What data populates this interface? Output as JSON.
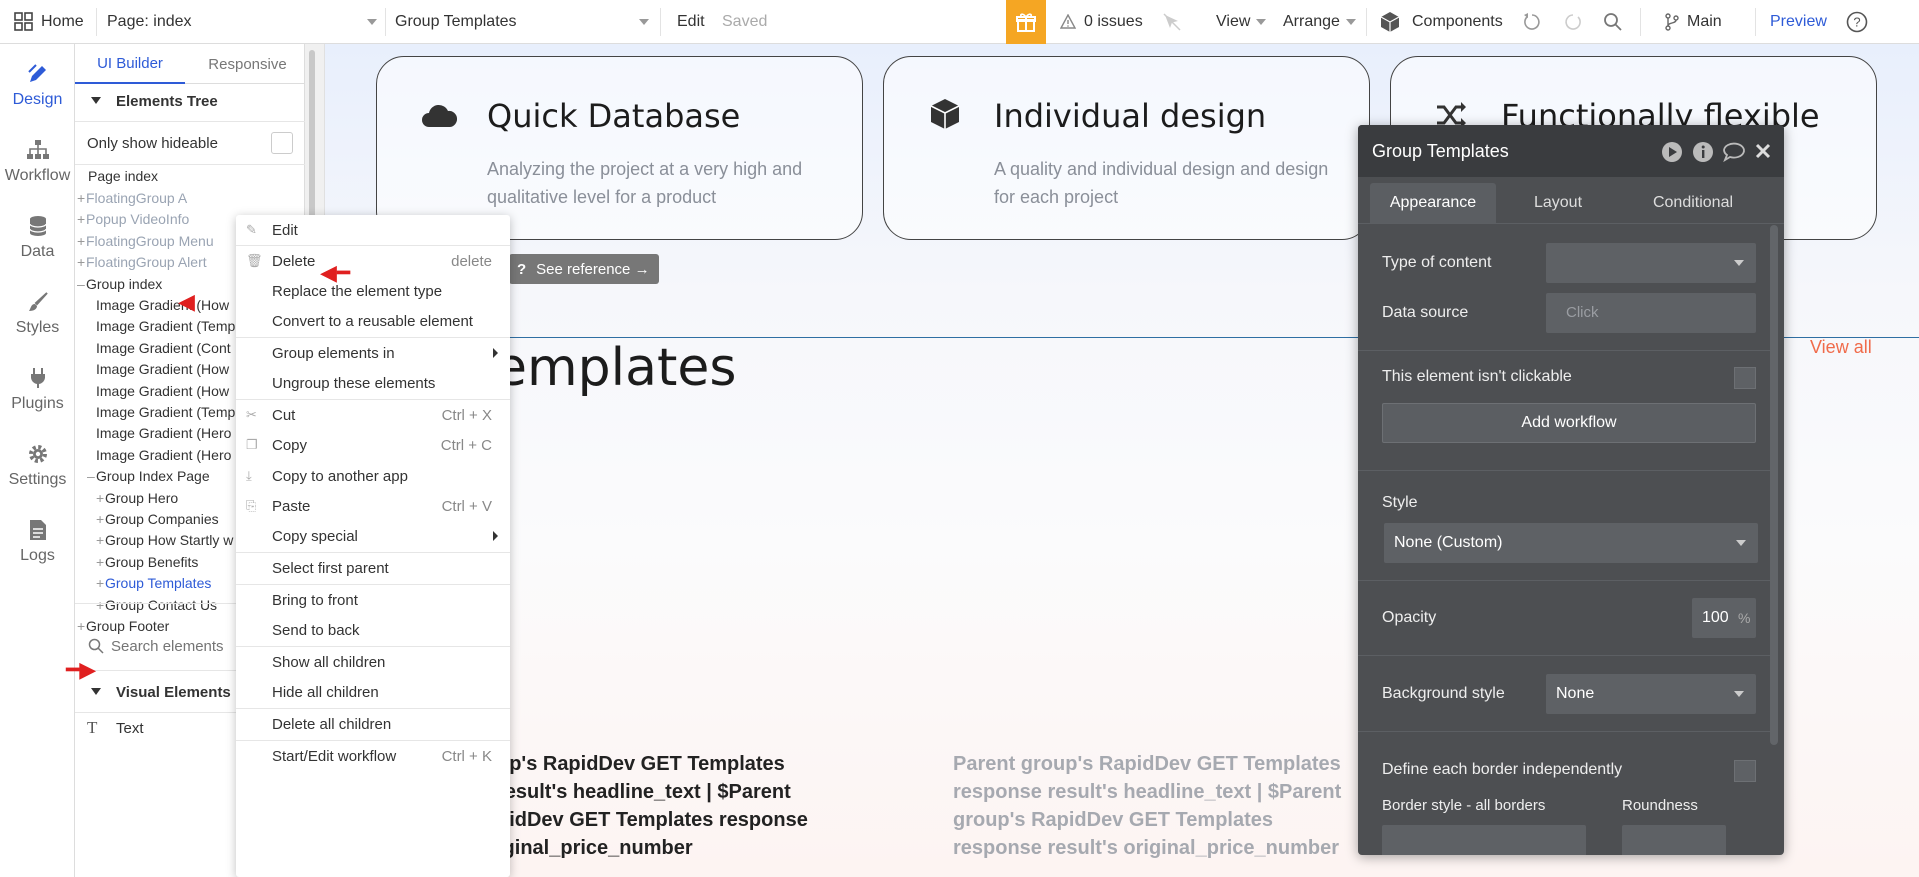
{
  "topbar": {
    "home": "Home",
    "page_select": "Page: index",
    "element_select": "Group Templates",
    "edit": "Edit",
    "saved": "Saved",
    "issues": "0 issues",
    "view": "View",
    "arrange": "Arrange",
    "components": "Components",
    "branch": "Main",
    "preview": "Preview",
    "gift_color": "#f5a623"
  },
  "leftnav": {
    "items": [
      {
        "label": "Design",
        "icon": "pen-icon"
      },
      {
        "label": "Workflow",
        "icon": "sitemap-icon"
      },
      {
        "label": "Data",
        "icon": "database-icon"
      },
      {
        "label": "Styles",
        "icon": "brush-icon"
      },
      {
        "label": "Plugins",
        "icon": "plug-icon"
      },
      {
        "label": "Settings",
        "icon": "gear-icon"
      },
      {
        "label": "Logs",
        "icon": "document-icon"
      }
    ],
    "active_color": "#2e5bd7"
  },
  "panel": {
    "tab_builder": "UI Builder",
    "tab_responsive": "Responsive",
    "elements_tree": "Elements Tree",
    "only_hideable": "Only show hideable",
    "page_index": "Page index",
    "tree": [
      {
        "label": "FloatingGroup A",
        "pm": "+",
        "faded": true
      },
      {
        "label": "Popup VideoInfo",
        "pm": "+",
        "faded": true
      },
      {
        "label": "FloatingGroup Menu",
        "pm": "+",
        "faded": true
      },
      {
        "label": "FloatingGroup Alert",
        "pm": "+",
        "faded": true
      },
      {
        "label": "Group index",
        "pm": "–",
        "faded": false
      },
      {
        "label": "Image Gradient (How",
        "pm": "",
        "faded": false
      },
      {
        "label": "Image Gradient (Temp",
        "pm": "",
        "faded": false
      },
      {
        "label": "Image Gradient (Cont",
        "pm": "",
        "faded": false
      },
      {
        "label": "Image Gradient (How",
        "pm": "",
        "faded": false
      },
      {
        "label": "Image Gradient (How",
        "pm": "",
        "faded": false
      },
      {
        "label": "Image Gradient (Temp",
        "pm": "",
        "faded": false
      },
      {
        "label": "Image Gradient (Hero",
        "pm": "",
        "faded": false
      },
      {
        "label": "Image Gradient (Hero",
        "pm": "",
        "faded": false
      },
      {
        "label": "Group Index Page",
        "pm": "–",
        "faded": false
      },
      {
        "label": "Group Hero",
        "pm": "+",
        "faded": false
      },
      {
        "label": "Group Companies",
        "pm": "+",
        "faded": false
      },
      {
        "label": "Group How Startly w",
        "pm": "+",
        "faded": false
      },
      {
        "label": "Group Benefits",
        "pm": "+",
        "faded": false
      },
      {
        "label": "Group Templates",
        "pm": "+",
        "faded": false,
        "selected": true
      },
      {
        "label": "Group Contact Us",
        "pm": "+",
        "faded": false
      },
      {
        "label": "Group Footer",
        "pm": "+",
        "faded": false
      }
    ],
    "search_placeholder": "Search elements",
    "visual_elements": "Visual Elements",
    "text_item": "Text"
  },
  "canvas": {
    "cards": [
      {
        "title": "Quick Database",
        "desc": "Analyzing the project at a very high and qualitative level for a product",
        "icon": "cloud-icon"
      },
      {
        "title": "Individual design",
        "desc": "A quality and individual design and design for each project",
        "icon": "cube-icon"
      },
      {
        "title": "Functionally flexible",
        "desc": "",
        "icon": "shuffle-icon"
      }
    ],
    "see_reference": "See reference →",
    "templates_heading": "emplates",
    "view_all": "View all",
    "dyn_text_1": "up's RapidDev GET Templates result's headline_text | $Parent pidDev GET Templates response iginal_price_number",
    "dyn_text_2": "Parent group's RapidDev GET Templates response result's headline_text | $Parent group's RapidDev GET Templates response result's original_price_number"
  },
  "context_menu": {
    "edit": "Edit",
    "delete": "Delete",
    "delete_shortcut": "delete",
    "replace": "Replace the element type",
    "convert": "Convert to a reusable element",
    "group_in": "Group elements in",
    "ungroup": "Ungroup these elements",
    "cut": "Cut",
    "cut_shortcut": "Ctrl + X",
    "copy": "Copy",
    "copy_shortcut": "Ctrl + C",
    "copy_app": "Copy to another app",
    "paste": "Paste",
    "paste_shortcut": "Ctrl + V",
    "copy_special": "Copy special",
    "select_parent": "Select first parent",
    "bring_front": "Bring to front",
    "send_back": "Send to back",
    "show_children": "Show all children",
    "hide_children": "Hide all children",
    "delete_children": "Delete all children",
    "start_workflow": "Start/Edit workflow",
    "start_workflow_shortcut": "Ctrl + K"
  },
  "property_editor": {
    "title": "Group Templates",
    "tabs": [
      "Appearance",
      "Layout",
      "Conditional"
    ],
    "type_of_content": "Type of content",
    "data_source": "Data source",
    "data_source_placeholder": "Click",
    "not_clickable": "This element isn't clickable",
    "add_workflow": "Add workflow",
    "style_label": "Style",
    "style_value": "None (Custom)",
    "opacity_label": "Opacity",
    "opacity_value": "100",
    "opacity_unit": "%",
    "background_label": "Background style",
    "background_value": "None",
    "border_independent": "Define each border independently",
    "border_style": "Border style - all borders",
    "roundness": "Roundness"
  }
}
